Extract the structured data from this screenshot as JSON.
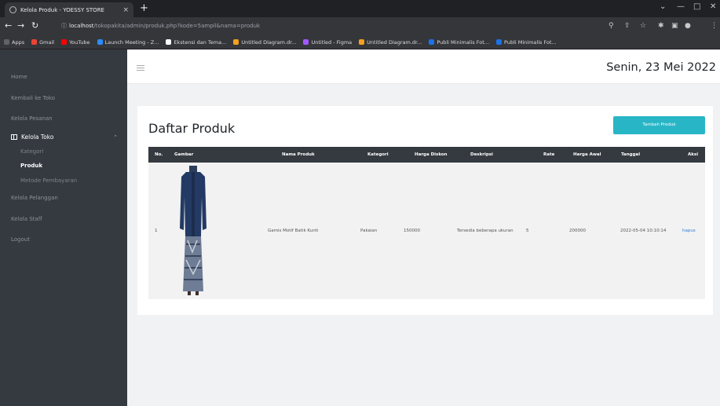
{
  "browser": {
    "tab_title": "Kelola Produk - YOESSY STORE",
    "tab_close": "×",
    "new_tab": "+",
    "address_host": "localhost",
    "address_path": "/tokopakita/admin/produk.php?kode=5ampil&nama=produk",
    "bookmarks": [
      {
        "label": "Apps",
        "color": "#5f6368"
      },
      {
        "label": "Gmail",
        "color": "#ea4335"
      },
      {
        "label": "YouTube",
        "color": "#ff0000"
      },
      {
        "label": "Launch Meeting - Z...",
        "color": "#2d8cff"
      },
      {
        "label": "Ekstensi dan Tema...",
        "color": "#ffffff"
      },
      {
        "label": "Untitled Diagram.dr...",
        "color": "#f4a020"
      },
      {
        "label": "Untitled - Figma",
        "color": "#a259ff"
      },
      {
        "label": "Untitled Diagram.dr...",
        "color": "#f4a020"
      },
      {
        "label": "Publi Minimalis Fot...",
        "color": "#1a73e8"
      },
      {
        "label": "Publi Minimalis Fot...",
        "color": "#1a73e8"
      }
    ]
  },
  "sidebar": {
    "home": "Home",
    "kembali": "Kembali ke Toko",
    "pesanan": "Kelola Pesanan",
    "group_label": "Kelola Toko",
    "kategori": "Kategori",
    "produk": "Produk",
    "metode": "Metode Pembayaran",
    "pelanggan": "Kelola Pelanggan",
    "staff": "Kelola Staff",
    "logout": "Logout"
  },
  "header": {
    "date": "Senin, 23 Mei 2022"
  },
  "main": {
    "title": "Daftar Produk",
    "add_button": "Tambah Produk",
    "columns": [
      "No.",
      "Gambar",
      "Nama Produk",
      "Kategori",
      "Harga Diskon",
      "Deskripsi",
      "Rate",
      "Harga Awal",
      "Tanggal",
      "Aksi"
    ],
    "rows": [
      {
        "no": "1",
        "nama": "Gamis Motif Batik Kunti",
        "kategori": "Pakaian",
        "harga_diskon": "150000",
        "deskripsi": "Tersedia beberapa ukuran",
        "rate": "5",
        "harga_awal": "200000",
        "tanggal": "2022-05-04 10:10:14",
        "aksi": "hapus"
      }
    ]
  },
  "colors": {
    "sidebar_bg": "#343a40",
    "button_accent": "#28b6c7",
    "link": "#2b7bd6"
  }
}
